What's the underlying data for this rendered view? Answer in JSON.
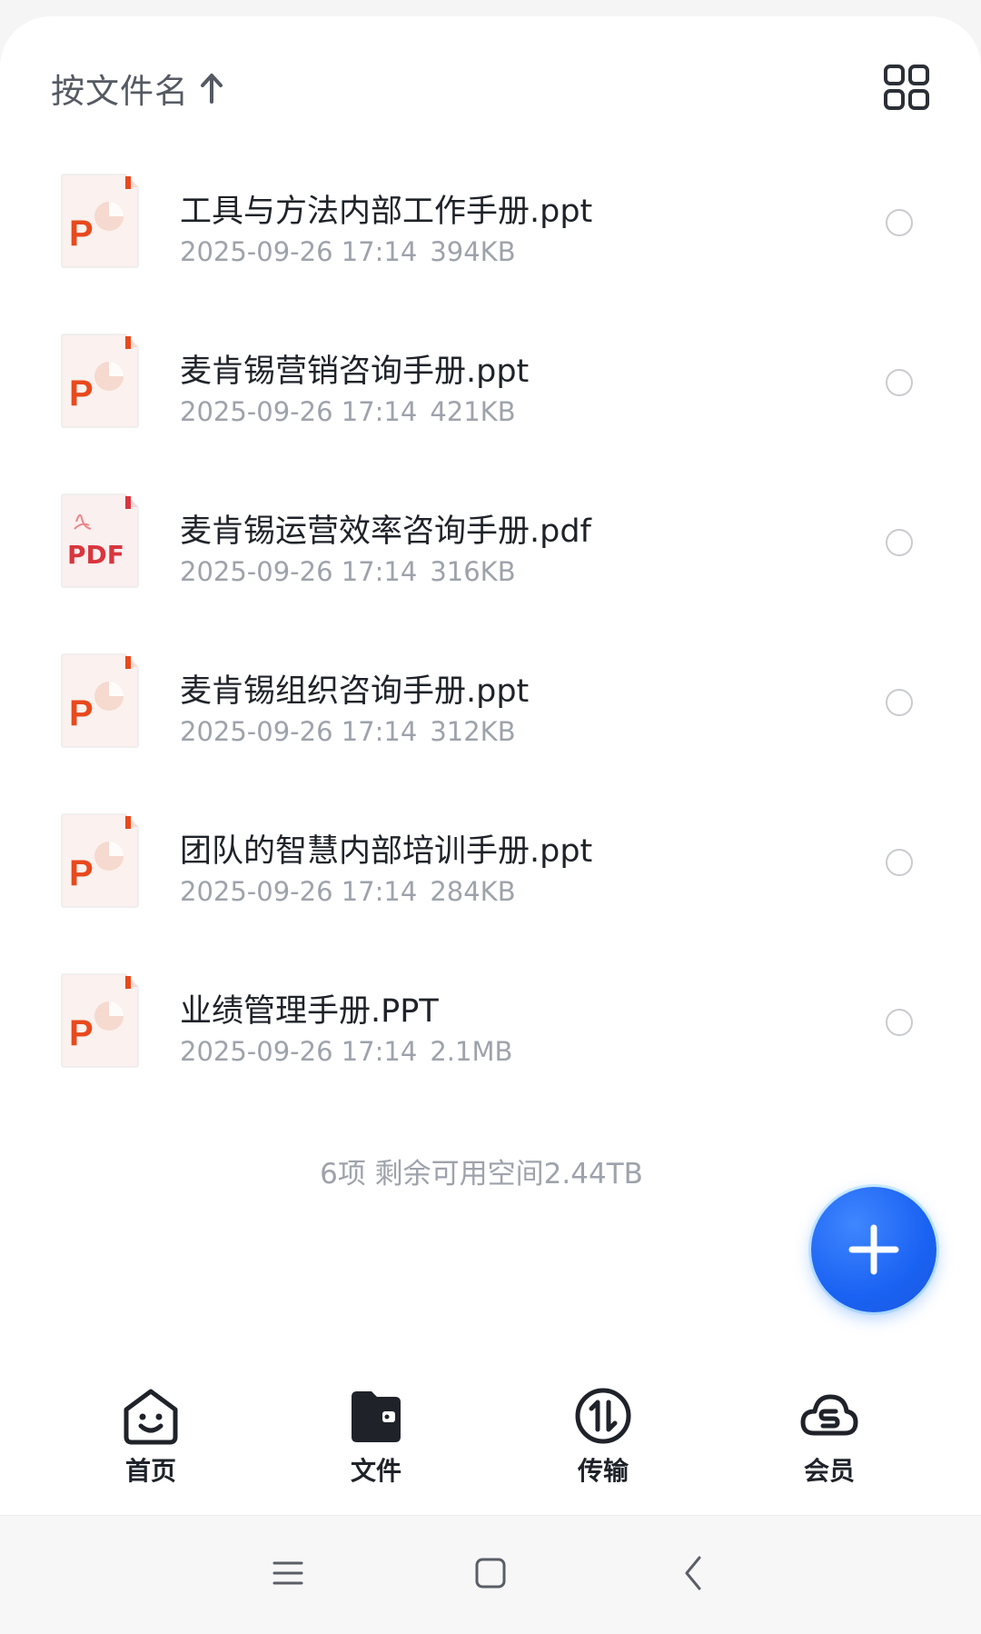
{
  "sort": {
    "label": "按文件名",
    "arrow_icon": "arrow-up-icon",
    "view_toggle_icon": "grid-view-icon"
  },
  "files": [
    {
      "name": "工具与方法内部工作手册.ppt",
      "date": "2025-09-26 17:14",
      "size": "394KB",
      "type": "ppt",
      "icon_label": "P"
    },
    {
      "name": "麦肯锡营销咨询手册.ppt",
      "date": "2025-09-26 17:14",
      "size": "421KB",
      "type": "ppt",
      "icon_label": "P"
    },
    {
      "name": "麦肯锡运营效率咨询手册.pdf",
      "date": "2025-09-26 17:14",
      "size": "316KB",
      "type": "pdf",
      "icon_label": "PDF"
    },
    {
      "name": "麦肯锡组织咨询手册.ppt",
      "date": "2025-09-26 17:14",
      "size": "312KB",
      "type": "ppt",
      "icon_label": "P"
    },
    {
      "name": "团队的智慧内部培训手册.ppt",
      "date": "2025-09-26 17:14",
      "size": "284KB",
      "type": "ppt",
      "icon_label": "P"
    },
    {
      "name": "业绩管理手册.PPT",
      "date": "2025-09-26 17:14",
      "size": "2.1MB",
      "type": "ppt",
      "icon_label": "P"
    }
  ],
  "summary": "6项 剩余可用空间2.44TB",
  "fab": {
    "icon": "plus-icon",
    "color": "#1a62f2"
  },
  "nav": {
    "home": {
      "label": "首页",
      "icon": "smiley-home-icon"
    },
    "files": {
      "label": "文件",
      "icon": "wallet-folder-icon"
    },
    "transfer": {
      "label": "传输",
      "icon": "transfer-arrows-icon"
    },
    "vip": {
      "label": "会员",
      "icon": "cloud-s-icon"
    }
  },
  "system_nav": {
    "menu_icon": "menu-icon",
    "home_icon": "square-home-icon",
    "back_icon": "back-chevron-icon"
  },
  "colors": {
    "ppt_accent": "#e8491d",
    "pdf_accent": "#d9363e",
    "text_primary": "#1f2329",
    "text_secondary": "#9ea3ab"
  }
}
